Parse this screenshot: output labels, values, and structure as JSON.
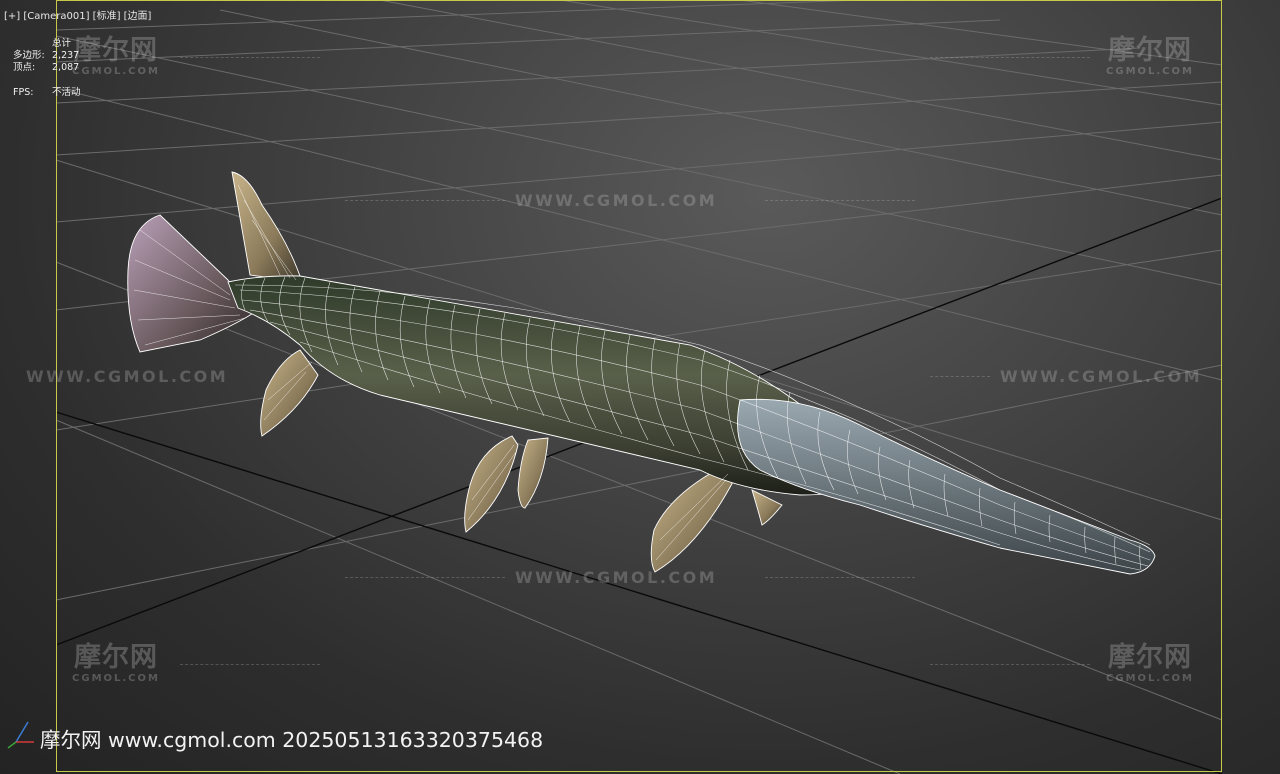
{
  "viewport": {
    "label": "[+] [Camera001] [标准] [边面]"
  },
  "stats": {
    "total_label": "总计",
    "polys_label": "多边形:",
    "polys_value": "2,237",
    "verts_label": "顶点:",
    "verts_value": "2,087",
    "fps_label": "FPS:",
    "fps_value": "不活动"
  },
  "watermark": {
    "url": "WWW.CGMOL.COM",
    "logo_cn": "摩尔网",
    "logo_en": "CGMOL.COM"
  },
  "footer": {
    "text": "摩尔网 www.cgmol.com 20250513163320375468"
  },
  "colors": {
    "frame_border": "#c8c84a",
    "grid_line": "#6b6b6b",
    "axis_line": "#0a0a0a",
    "wire": "#ffffff"
  },
  "icons": {
    "gizmo": "axis-gizmo-icon",
    "model": "gar-fish-wireframe-model"
  }
}
